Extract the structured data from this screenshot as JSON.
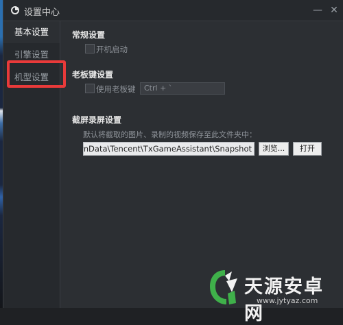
{
  "window": {
    "title": "设置中心",
    "minimize_glyph": "—",
    "close_glyph": "✕"
  },
  "sidebar": {
    "items": [
      {
        "label": "基本设置",
        "active": true
      },
      {
        "label": "引擎设置",
        "active": false
      },
      {
        "label": "机型设置",
        "active": false
      }
    ],
    "highlight_color": "#e83a3a"
  },
  "general": {
    "title": "常规设置",
    "autostart_label": "开机启动",
    "autostart_checked": false
  },
  "bosskey": {
    "title": "老板键设置",
    "enable_label": "使用老板键",
    "enable_checked": false,
    "hotkey_value": "Ctrl + `"
  },
  "screenshot": {
    "title": "截屏录屏设置",
    "hint": "默认将截取的图片、录制的视频保存至此文件夹中：",
    "path_value": "gramData\\Tencent\\TxGameAssistant\\Snapshot",
    "browse_label": "浏览...",
    "open_label": "打开"
  },
  "watermark": {
    "name": "天源安卓网",
    "url": "www.jytyaz.com"
  }
}
